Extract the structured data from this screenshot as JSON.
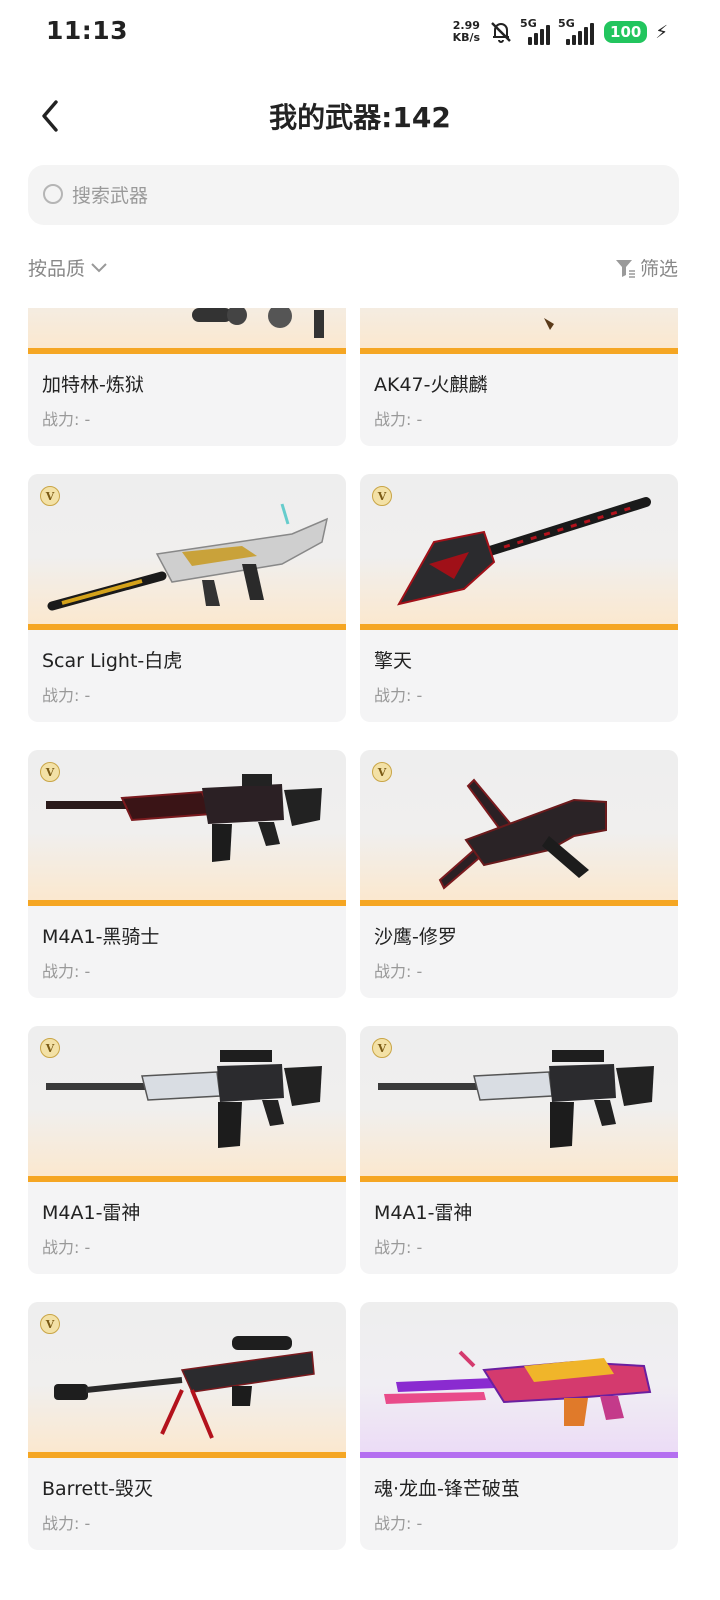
{
  "status_bar": {
    "time": "11:13",
    "net_speed_value": "2.99",
    "net_speed_unit": "KB/s",
    "sim1": "5G",
    "sim2": "5G",
    "battery": "100"
  },
  "header": {
    "back_icon": "chevron-left-icon",
    "title": "我的武器:142"
  },
  "search": {
    "placeholder": "搜索武器",
    "value": ""
  },
  "toolbar": {
    "sort_label": "按品质",
    "filter_label": "筛选"
  },
  "colors": {
    "gold_quality": "#f5a623",
    "purple_quality": "#b46ef0",
    "battery_green": "#22c55e"
  },
  "weapons": [
    {
      "name": "加特林-炼狱",
      "power": "战力: -",
      "quality": "gold",
      "badge": ""
    },
    {
      "name": "AK47-火麒麟",
      "power": "战力: -",
      "quality": "gold",
      "badge": ""
    },
    {
      "name": "Scar Light-白虎",
      "power": "战力: -",
      "quality": "gold",
      "badge": "V"
    },
    {
      "name": "擎天",
      "power": "战力: -",
      "quality": "gold",
      "badge": "V"
    },
    {
      "name": "M4A1-黑骑士",
      "power": "战力: -",
      "quality": "gold",
      "badge": "V"
    },
    {
      "name": "沙鹰-修罗",
      "power": "战力: -",
      "quality": "gold",
      "badge": "V"
    },
    {
      "name": "M4A1-雷神",
      "power": "战力: -",
      "quality": "gold",
      "badge": "V"
    },
    {
      "name": "M4A1-雷神",
      "power": "战力: -",
      "quality": "gold",
      "badge": "V"
    },
    {
      "name": "Barrett-毁灭",
      "power": "战力: -",
      "quality": "gold",
      "badge": "V"
    },
    {
      "name": "魂·龙血-锋芒破茧",
      "power": "战力: -",
      "quality": "purple",
      "badge": ""
    }
  ]
}
